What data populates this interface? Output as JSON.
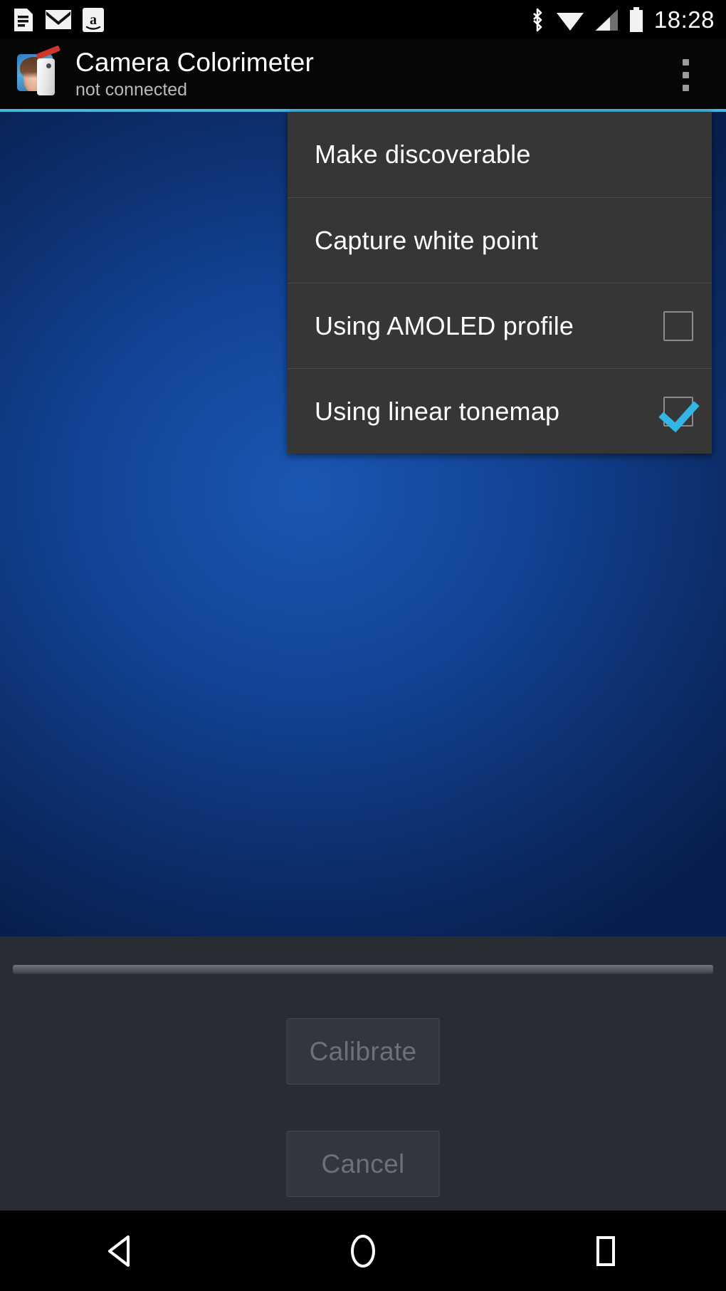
{
  "status_bar": {
    "notifications": [
      {
        "icon": "document-icon",
        "name": "document-notification-icon"
      },
      {
        "icon": "envelope-icon",
        "name": "email-notification-icon"
      },
      {
        "icon": "amazon-icon",
        "name": "amazon-notification-icon"
      }
    ],
    "system_icons": [
      {
        "icon": "bluetooth-icon"
      },
      {
        "icon": "wifi-icon"
      },
      {
        "icon": "cellular-signal-icon"
      },
      {
        "icon": "battery-icon"
      }
    ],
    "clock": "18:28"
  },
  "action_bar": {
    "app_icon": "camera-colorimeter-app-icon",
    "title": "Camera Colorimeter",
    "subtitle": "not connected",
    "overflow_icon": "overflow-menu-icon",
    "accent_color": "#49b6e0",
    "background_color": "#060606"
  },
  "overflow_menu": {
    "background_color": "#363636",
    "items": [
      {
        "label": "Make discoverable",
        "type": "action",
        "checked": null
      },
      {
        "label": "Capture white point",
        "type": "action",
        "checked": null
      },
      {
        "label": "Using AMOLED profile",
        "type": "checkbox",
        "checked": false
      },
      {
        "label": "Using linear tonemap",
        "type": "checkbox",
        "checked": true
      }
    ],
    "checkbox_checked_color": "#33b5e5"
  },
  "content": {
    "background_description": "blue radial gradient backdrop",
    "colors": {
      "center": "#1a57b4",
      "edge": "#081f4d"
    }
  },
  "bottom_panel": {
    "background_color": "#282c33",
    "seekbar": {
      "name": "brightness-seekbar",
      "value_visible": false
    },
    "buttons": [
      {
        "label": "Calibrate",
        "enabled": false
      },
      {
        "label": "Cancel",
        "enabled": false
      }
    ]
  },
  "nav_bar": {
    "buttons": [
      {
        "icon": "back-icon",
        "label": "Back"
      },
      {
        "icon": "home-icon",
        "label": "Home"
      },
      {
        "icon": "recents-icon",
        "label": "Recent apps"
      }
    ]
  }
}
